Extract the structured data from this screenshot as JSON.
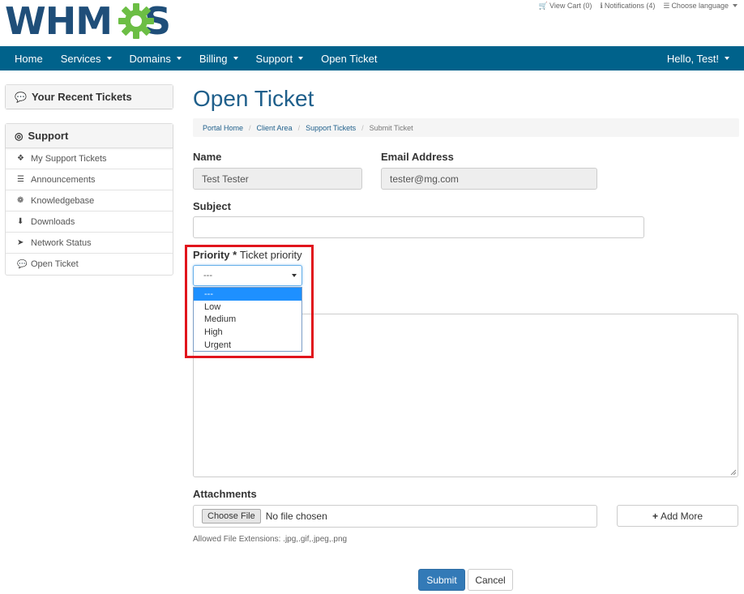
{
  "header": {
    "logo_text_left": "WHM",
    "logo_text_right": "S",
    "top_links": {
      "cart": "View Cart (0)",
      "notifications": "Notifications (4)",
      "language": "Choose language"
    }
  },
  "nav": {
    "items": [
      {
        "label": "Home"
      },
      {
        "label": "Services"
      },
      {
        "label": "Domains"
      },
      {
        "label": "Billing"
      },
      {
        "label": "Support"
      },
      {
        "label": "Open Ticket"
      }
    ],
    "user": "Hello, Test!"
  },
  "sidebar": {
    "recent_title": "Your Recent Tickets",
    "support_title": "Support",
    "items": [
      {
        "label": "My Support Tickets",
        "icon": "ticket-icon"
      },
      {
        "label": "Announcements",
        "icon": "list-icon"
      },
      {
        "label": "Knowledgebase",
        "icon": "info-icon"
      },
      {
        "label": "Downloads",
        "icon": "download-icon"
      },
      {
        "label": "Network Status",
        "icon": "rocket-icon"
      },
      {
        "label": "Open Ticket",
        "icon": "comments-icon"
      }
    ]
  },
  "main": {
    "title": "Open Ticket",
    "breadcrumb": [
      "Portal Home",
      "Client Area",
      "Support Tickets",
      "Submit Ticket"
    ],
    "name_label": "Name",
    "name_value": "Test Tester",
    "email_label": "Email Address",
    "email_value": "tester@mg.com",
    "subject_label": "Subject",
    "subject_value": "",
    "priority_label": "Priority",
    "priority_required": "*",
    "priority_hint": "Ticket priority",
    "priority_selected": "---",
    "priority_options": [
      "---",
      "Low",
      "Medium",
      "High",
      "Urgent"
    ],
    "attachments_label": "Attachments",
    "choose_file": "Choose File",
    "no_file": "No file chosen",
    "add_more": "Add More",
    "allowed_ext": "Allowed File Extensions: .jpg,.gif,.jpeg,.png",
    "submit": "Submit",
    "cancel": "Cancel"
  },
  "colors": {
    "navbar": "#00628b",
    "logo_blue": "#1f4e79",
    "logo_green": "#6cbe45",
    "highlight": "#e1141c",
    "primary_button": "#337ab7"
  }
}
